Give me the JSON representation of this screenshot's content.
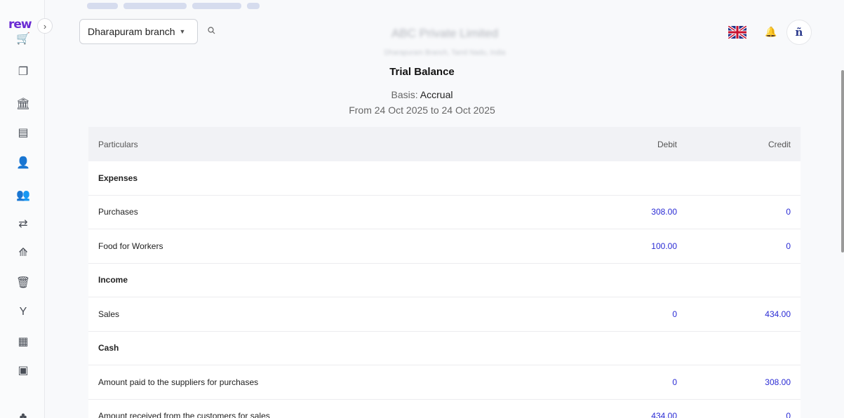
{
  "app": {
    "logo": "rew"
  },
  "sidebar": {
    "items": [
      {
        "icon": "cart-icon",
        "glyph": "🛒"
      },
      {
        "icon": "documents-icon",
        "glyph": "❐"
      },
      {
        "icon": "bank-icon",
        "glyph": "🏛"
      },
      {
        "icon": "book-icon",
        "glyph": "▤"
      },
      {
        "icon": "user-check-icon",
        "glyph": "👤"
      },
      {
        "icon": "users-icon",
        "glyph": "👥"
      },
      {
        "icon": "transfer-icon",
        "glyph": "⇄"
      },
      {
        "icon": "chart-icon",
        "glyph": "⟰"
      },
      {
        "icon": "trash-icon",
        "glyph": "🗑"
      },
      {
        "icon": "merge-icon",
        "glyph": "Y"
      },
      {
        "icon": "calculator-icon",
        "glyph": "▦"
      },
      {
        "icon": "id-card-icon",
        "glyph": "▣"
      },
      {
        "icon": "plant-icon",
        "glyph": "♣"
      }
    ]
  },
  "header": {
    "branch": "Dharapuram branch",
    "company_name": "ABC Private Limited",
    "company_sub": "Dharapuram Branch, Tamil Nadu, India"
  },
  "report": {
    "title": "Trial Balance",
    "basis_label": "Basis:",
    "basis_value": "Accrual",
    "range": "From 24 Oct 2025 to 24 Oct 2025",
    "columns": [
      "Particulars",
      "Debit",
      "Credit"
    ],
    "rows": [
      {
        "type": "group",
        "label": "Expenses"
      },
      {
        "type": "item",
        "label": "Purchases",
        "debit": "308.00",
        "credit": "0"
      },
      {
        "type": "item",
        "label": "Food for Workers",
        "debit": "100.00",
        "credit": "0"
      },
      {
        "type": "group",
        "label": "Income"
      },
      {
        "type": "item",
        "label": "Sales",
        "debit": "0",
        "credit": "434.00"
      },
      {
        "type": "group",
        "label": "Cash"
      },
      {
        "type": "item",
        "label": "Amount paid to the suppliers for purchases",
        "debit": "0",
        "credit": "308.00"
      },
      {
        "type": "item",
        "label": "Amount received from the customers for sales",
        "debit": "434.00",
        "credit": "0"
      }
    ]
  },
  "colors": {
    "accent": "#6a2bd3",
    "link": "#2a2bd4"
  }
}
